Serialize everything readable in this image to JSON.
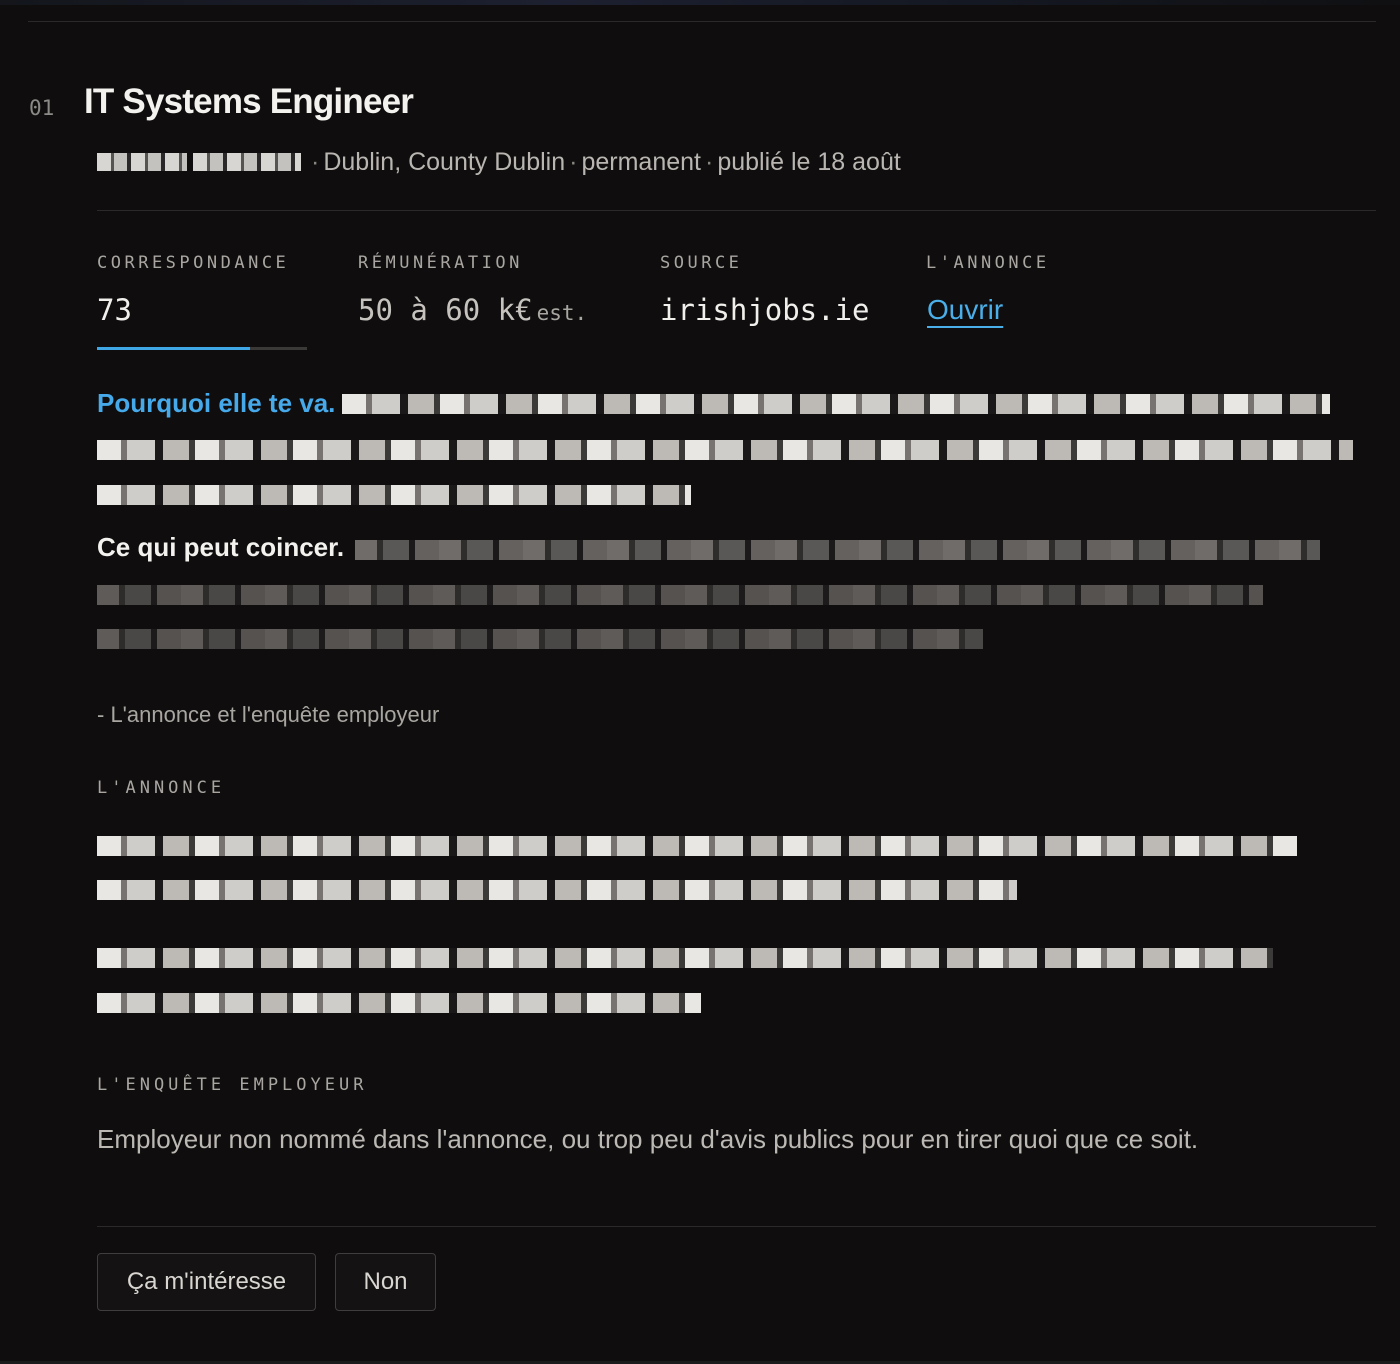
{
  "job": {
    "index": "01",
    "title": "IT Systems Engineer",
    "location": "Dublin, County Dublin",
    "contract": "permanent",
    "posted": "publié le 18 août",
    "separator": "·"
  },
  "stats": {
    "match": {
      "label": "CORRESPONDANCE",
      "value": "73",
      "progress_fraction": 0.73
    },
    "pay": {
      "label": "RÉMUNÉRATION",
      "value": "50 à 60 k€",
      "suffix": "est."
    },
    "source": {
      "label": "SOURCE",
      "value": "irishjobs.ie"
    },
    "listing": {
      "label": "L'ANNONCE",
      "link": "Ouvrir"
    }
  },
  "analysis": {
    "why_lead": "Pourquoi elle te va.",
    "catch_lead": "Ce qui peut coincer.",
    "source_note": "- L'annonce et l'enquête employeur"
  },
  "sections": {
    "listing_label": "L'ANNONCE",
    "survey_label": "L'ENQUÊTE EMPLOYEUR",
    "survey_text": "Employeur non nommé dans l'annonce, ou trop peu d'avis publics pour en tirer quoi que ce soit."
  },
  "actions": {
    "interested": "Ça m'intéresse",
    "no": "Non"
  },
  "colors": {
    "background": "#0f0d0d",
    "accent": "#46a9ea",
    "text": "#f4f2ef",
    "muted": "#a9a6a2"
  }
}
